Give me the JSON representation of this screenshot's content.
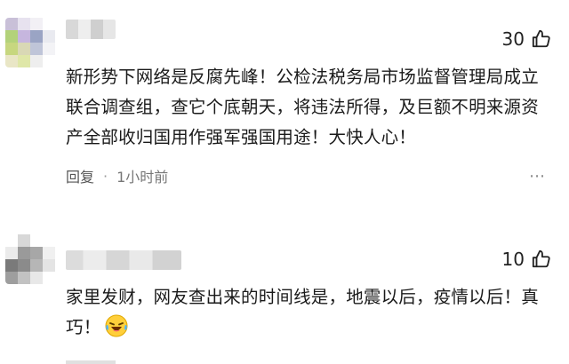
{
  "comments": [
    {
      "likes": "30",
      "text": "新形势下网络是反腐先峰！公检法税务局市场监督管理局成立联合调查组，查它个底朝天，将违法所得，及巨额不明来源资产全部收归国用作强军强国用途！大快人心！",
      "reply_label": "回复",
      "separator": "·",
      "time": "1小时前",
      "more": "⋯"
    },
    {
      "likes": "10",
      "text": "家里发财，网友查出来的时间线是，地震以后，疫情以后！真巧！",
      "emoji": "laughing-tears-emoji"
    }
  ],
  "colors": {
    "text": "#1a1a1a",
    "meta": "#555555",
    "likes": "#222222"
  }
}
